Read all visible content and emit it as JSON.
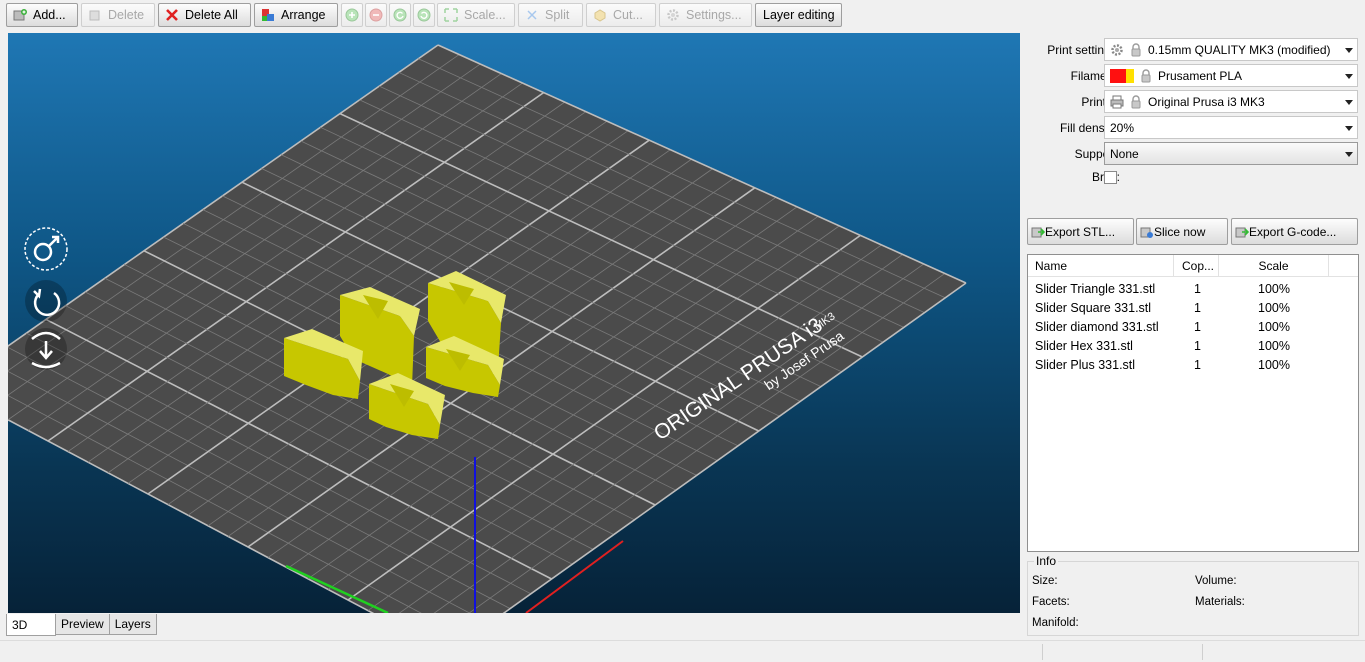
{
  "toolbar": {
    "add": "Add...",
    "delete": "Delete",
    "delete_all": "Delete All",
    "arrange": "Arrange",
    "scale": "Scale...",
    "split": "Split",
    "cut": "Cut...",
    "settings": "Settings...",
    "layer_editing": "Layer editing"
  },
  "bed": {
    "brand_line1": "ORIGINAL PRUSA i3",
    "brand_model": "MK3",
    "brand_line2": "by Josef Prusa"
  },
  "tabs": [
    "3D",
    "Preview",
    "Layers"
  ],
  "settings": {
    "print_label": "Print settings:",
    "print_value": "0.15mm QUALITY MK3 (modified)",
    "filament_label": "Filament:",
    "filament_value": "Prusament PLA",
    "printer_label": "Printer:",
    "printer_value": "Original Prusa i3 MK3",
    "fill_label": "Fill density:",
    "fill_value": "20%",
    "support_label": "Support:",
    "support_value": "None",
    "brim_label": "Brim:",
    "brim_checked": false
  },
  "actions": {
    "export_stl": "Export STL...",
    "slice_now": "Slice now",
    "export_gcode": "Export G-code..."
  },
  "objects": {
    "headers": [
      "Name",
      "Cop...",
      "Scale"
    ],
    "rows": [
      {
        "name": "Slider Triangle 331.stl",
        "copies": "1",
        "scale": "100%"
      },
      {
        "name": "Slider Square 331.stl",
        "copies": "1",
        "scale": "100%"
      },
      {
        "name": "Slider diamond 331.stl",
        "copies": "1",
        "scale": "100%"
      },
      {
        "name": "Slider Hex 331.stl",
        "copies": "1",
        "scale": "100%"
      },
      {
        "name": "Slider Plus 331.stl",
        "copies": "1",
        "scale": "100%"
      }
    ]
  },
  "info": {
    "title": "Info",
    "size_label": "Size:",
    "volume_label": "Volume:",
    "facets_label": "Facets:",
    "materials_label": "Materials:",
    "manifold_label": "Manifold:"
  },
  "colors": {
    "model_yellow": "#d8d800",
    "bed_grey": "#4b4b4b",
    "axis_x": "#e02020",
    "axis_y": "#20d020",
    "axis_z": "#1010e0"
  }
}
